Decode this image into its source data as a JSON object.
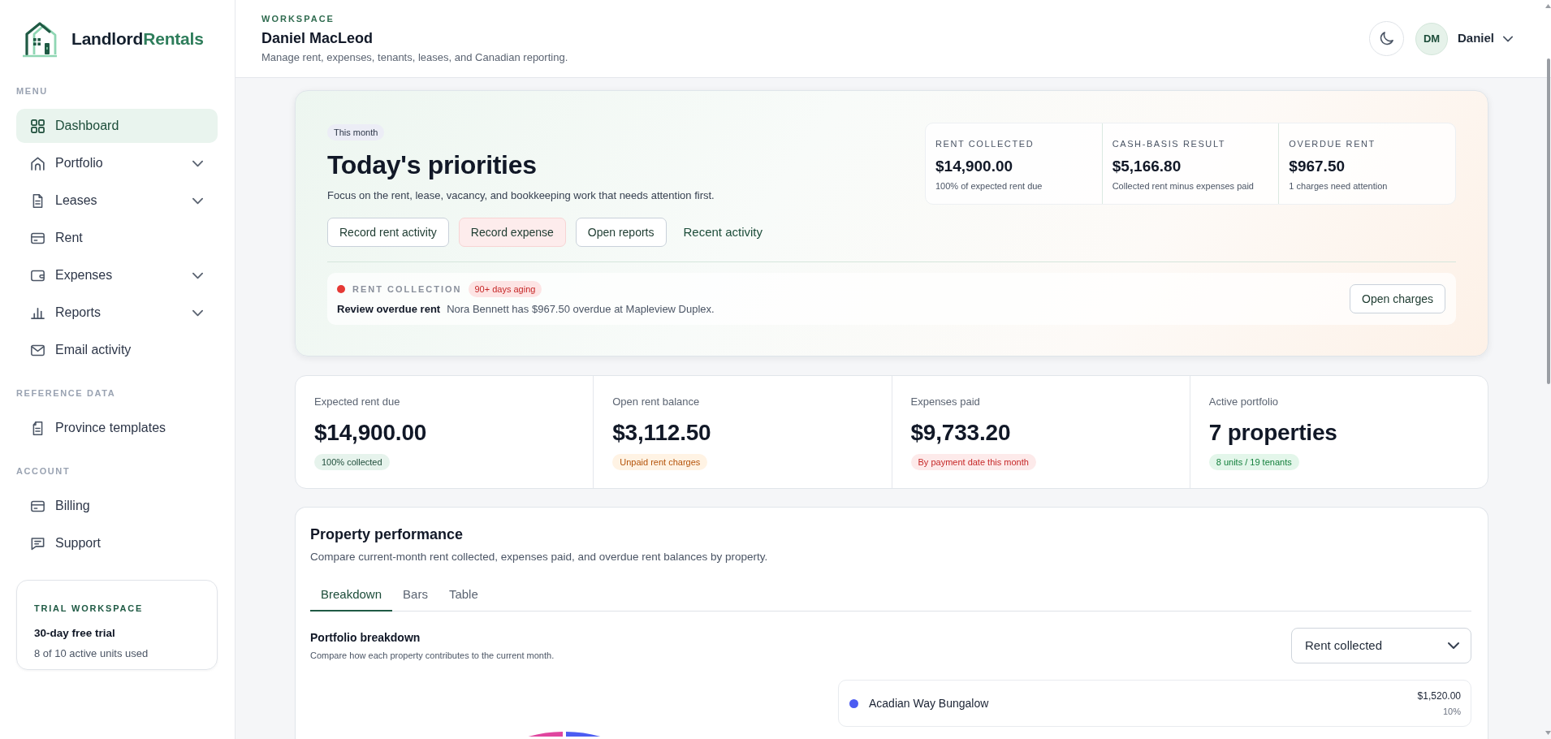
{
  "brand": {
    "name": "Landlord",
    "accent": "Rentals"
  },
  "sidebar": {
    "sections": [
      {
        "title": "MENU",
        "items": [
          {
            "label": "Dashboard",
            "selected": true,
            "submenu": false
          },
          {
            "label": "Portfolio",
            "selected": false,
            "submenu": true
          },
          {
            "label": "Leases",
            "selected": false,
            "submenu": true
          },
          {
            "label": "Rent",
            "selected": false,
            "submenu": false
          },
          {
            "label": "Expenses",
            "selected": false,
            "submenu": true
          },
          {
            "label": "Reports",
            "selected": false,
            "submenu": true
          },
          {
            "label": "Email activity",
            "selected": false,
            "submenu": false
          }
        ]
      },
      {
        "title": "REFERENCE DATA",
        "items": [
          {
            "label": "Province templates",
            "selected": false,
            "submenu": false
          }
        ]
      },
      {
        "title": "ACCOUNT",
        "items": [
          {
            "label": "Billing",
            "selected": false,
            "submenu": false
          },
          {
            "label": "Support",
            "selected": false,
            "submenu": false
          }
        ]
      }
    ],
    "trial": {
      "eyebrow": "TRIAL WORKSPACE",
      "title": "30-day free trial",
      "text": "8 of 10 active units used"
    }
  },
  "header": {
    "eyebrow": "WORKSPACE",
    "title": "Daniel MacLeod",
    "subtitle": "Manage rent, expenses, tenants, leases, and Canadian reporting.",
    "user": {
      "initials": "DM",
      "name": "Daniel"
    }
  },
  "priorities": {
    "badge": "This month",
    "title": "Today's priorities",
    "subtitle": "Focus on the rent, lease, vacancy, and bookkeeping work that needs attention first.",
    "actions": [
      {
        "label": "Record rent activity",
        "kind": "outline"
      },
      {
        "label": "Record expense",
        "kind": "danger"
      },
      {
        "label": "Open reports",
        "kind": "outline"
      },
      {
        "label": "Recent activity",
        "kind": "link"
      }
    ],
    "summary": [
      {
        "label": "RENT COLLECTED",
        "value": "$14,900.00",
        "note": "100% of expected rent due"
      },
      {
        "label": "CASH-BASIS RESULT",
        "value": "$5,166.80",
        "note": "Collected rent minus expenses paid"
      },
      {
        "label": "OVERDUE RENT",
        "value": "$967.50",
        "note": "1 charges need attention"
      }
    ],
    "alert": {
      "category": "RENT COLLECTION",
      "tag": "90+ days aging",
      "title": "Review overdue rent",
      "text": "Nora Bennett has $967.50 overdue at Mapleview Duplex.",
      "button": "Open charges"
    }
  },
  "stats": [
    {
      "label": "Expected rent due",
      "value": "$14,900.00",
      "tag": "100% collected",
      "kind": "success"
    },
    {
      "label": "Open rent balance",
      "value": "$3,112.50",
      "tag": "Unpaid rent charges",
      "kind": "warning"
    },
    {
      "label": "Expenses paid",
      "value": "$9,733.20",
      "tag": "By payment date this month",
      "kind": "danger"
    },
    {
      "label": "Active portfolio",
      "value": "7 properties",
      "tag": "8 units / 19 tenants",
      "kind": "positive"
    }
  ],
  "performance": {
    "title": "Property performance",
    "subtitle": "Compare current-month rent collected, expenses paid, and overdue rent balances by property.",
    "tabs": [
      {
        "label": "Breakdown",
        "selected": true
      },
      {
        "label": "Bars",
        "selected": false
      },
      {
        "label": "Table",
        "selected": false
      }
    ],
    "breakdown": {
      "title": "Portfolio breakdown",
      "subtitle": "Compare how each property contributes to the current month.",
      "metric": "Rent collected",
      "items": [
        {
          "name": "Acadian Way Bungalow",
          "color": "#4c5cf2",
          "amount": "$1,520.00",
          "share": "10%"
        }
      ]
    }
  }
}
